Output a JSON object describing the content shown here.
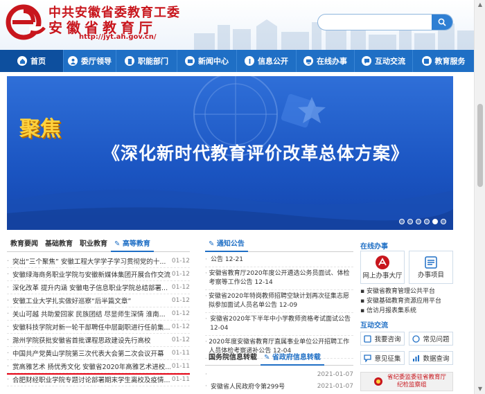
{
  "header": {
    "title_line1": "中共安徽省委教育工委",
    "title_line2": "安徽省教育厅",
    "url": "http://jyt.ah.gov.cn/",
    "search": {
      "value": "",
      "placeholder": ""
    },
    "brand_color": "#c8161d"
  },
  "nav": {
    "items": [
      {
        "label": "首页",
        "icon": "home-icon"
      },
      {
        "label": "委厅领导",
        "icon": "person-icon"
      },
      {
        "label": "职能部门",
        "icon": "building-icon"
      },
      {
        "label": "新闻中心",
        "icon": "news-icon"
      },
      {
        "label": "信息公开",
        "icon": "info-icon"
      },
      {
        "label": "在线办事",
        "icon": "online-icon"
      },
      {
        "label": "互动交流",
        "icon": "chat-icon"
      },
      {
        "label": "教育服务",
        "icon": "service-icon"
      }
    ],
    "color": "#1f6fc5"
  },
  "banner": {
    "emblem_text": "聚焦",
    "title": "《深化新时代教育评价改革总体方案》",
    "slides": 6,
    "active_slide": 5
  },
  "news": {
    "tabs": [
      "教育要闻",
      "基础教育",
      "职业教育",
      "高等教育"
    ],
    "active_tab": 3,
    "items": [
      {
        "title": "突出“三个聚焦” 安徽工程大学学子学习贯彻党的十...",
        "date": "01-12"
      },
      {
        "title": "安徽绿海商务职业学院与安徽新媒体集团开展合作交流",
        "date": "01-12"
      },
      {
        "title": "深化改革 提升内涵 安徽电子信息职业学院总结部署...",
        "date": "01-12"
      },
      {
        "title": "安徽工业大学扎实做好巡察“后半篇文章”",
        "date": "01-12"
      },
      {
        "title": "关山可越 共助爱回家 民族团结 尽显师生深情 淮南...",
        "date": "01-12"
      },
      {
        "title": "安徽科技学院对新一轮干部聘任中层副职进行任前集...",
        "date": "01-12"
      },
      {
        "title": "滁州学院获批安徽省首批课程思政建设先行高校",
        "date": "01-12"
      },
      {
        "title": "中国共产党黄山学院第三次代表大会第二次会议开幕",
        "date": "01-11"
      },
      {
        "title": "赏高雅艺术 扬优秀文化 安徽省2020年高雅艺术进校...",
        "date": "01-11"
      },
      {
        "title": "合肥财经职业学院专题讨论部署期末学生离校及疫情...",
        "date": "01-11"
      }
    ]
  },
  "notices": {
    "title": "通知公告",
    "items": [
      "公告  12-21",
      "安徽省教育厅2020年度公开遴选公务员面试、体检考察等工作公告  12-14",
      "安徽省2020年特岗教师招聘空缺计划再次征集志愿拟参加面试人员名单公告  12-09",
      "安徽省2020年下半年中小学教师资格考试面试公告  12-04",
      "2020年度安徽省教育厅直属事业单位公开招聘工作人员体检考察递补公告  12-04"
    ]
  },
  "gov_info": {
    "tabs": [
      "国务院信息转载",
      "省政府信息转载"
    ],
    "active_tab": 1,
    "items": [
      {
        "title": "",
        "date": "2021-01-07"
      },
      {
        "title": "安徽省人民政府令第299号",
        "date": "2021-01-07"
      }
    ]
  },
  "online": {
    "title": "在线办事",
    "boxes": [
      {
        "label": "网上办事大厅",
        "icon": "hall-icon"
      },
      {
        "label": "办事项目",
        "icon": "list-icon"
      }
    ],
    "links": [
      "安徽省教育管理公共平台",
      "安徽基础教育资源应用平台",
      "信访月报表集系统"
    ]
  },
  "interaction": {
    "title": "互动交流",
    "buttons": [
      {
        "label": "我要咨询",
        "icon": "consult-icon"
      },
      {
        "label": "常见问题",
        "icon": "faq-icon"
      },
      {
        "label": "意见征集",
        "icon": "opinion-icon"
      },
      {
        "label": "数据查询",
        "icon": "data-icon"
      }
    ]
  },
  "discipline_box": {
    "line1": "省纪委监委驻省教育厅",
    "line2": "纪检监察组"
  }
}
